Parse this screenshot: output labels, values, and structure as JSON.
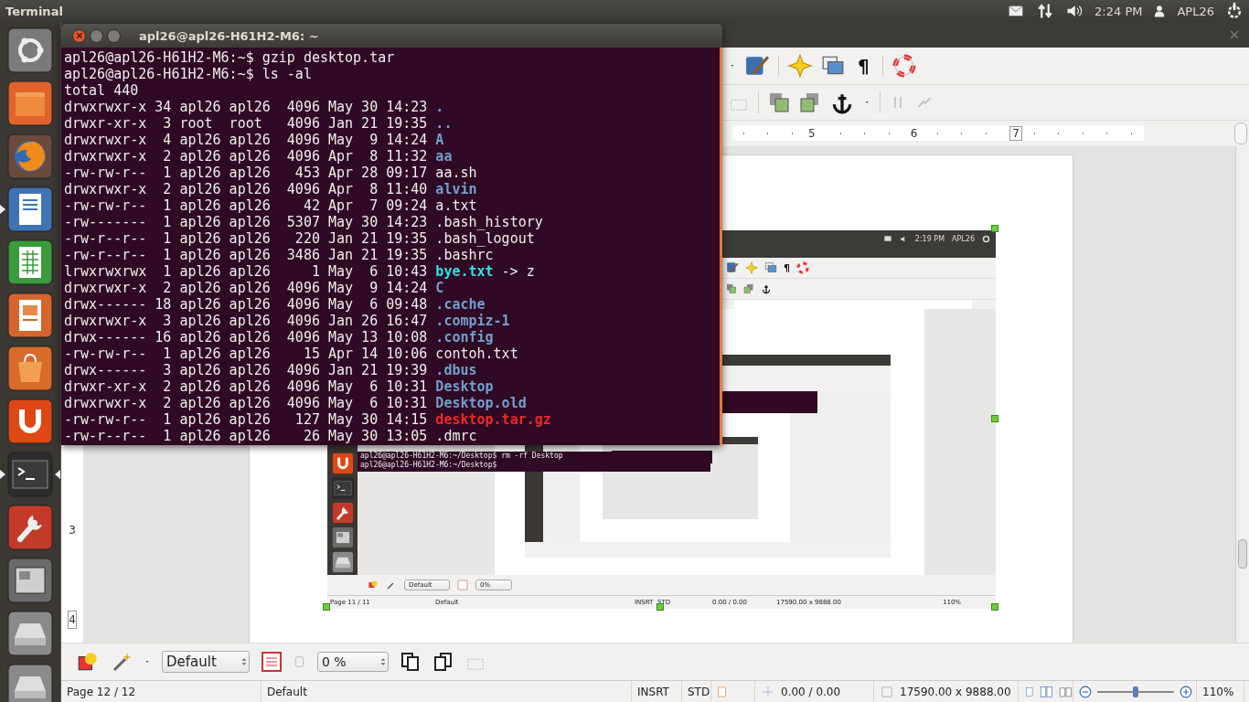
{
  "top_panel": {
    "app_title": "Terminal",
    "time": "2:24 PM",
    "user": "APL26"
  },
  "launcher": [
    {
      "kind": "dash",
      "running": false,
      "focused": false
    },
    {
      "kind": "files",
      "running": false,
      "focused": false
    },
    {
      "kind": "browser",
      "running": false,
      "focused": false
    },
    {
      "kind": "writer",
      "running": true,
      "focused": false
    },
    {
      "kind": "calc",
      "running": false,
      "focused": false
    },
    {
      "kind": "impress",
      "running": false,
      "focused": false
    },
    {
      "kind": "store",
      "running": false,
      "focused": false
    },
    {
      "kind": "cloud",
      "running": false,
      "focused": false
    },
    {
      "kind": "terminal",
      "running": true,
      "focused": true
    },
    {
      "kind": "settings",
      "running": false,
      "focused": false
    },
    {
      "kind": "workspaces",
      "running": false,
      "focused": false
    },
    {
      "kind": "drive",
      "running": false,
      "focused": false
    },
    {
      "kind": "drive",
      "running": false,
      "focused": false
    }
  ],
  "terminal": {
    "title": "apl26@apl26-H61H2-M6: ~",
    "lines": [
      {
        "kind": "plain",
        "text": "apl26@apl26-H61H2-M6:~$ gzip desktop.tar"
      },
      {
        "kind": "plain",
        "text": "apl26@apl26-H61H2-M6:~$ ls -al"
      },
      {
        "kind": "plain",
        "text": "total 440"
      },
      {
        "kind": "dir",
        "info": "drwxrwxr-x 34 apl26 apl26  4096 May 30 14:23",
        "name": "."
      },
      {
        "kind": "dir",
        "info": "drwxr-xr-x  3 root  root   4096 Jan 21 19:35",
        "name": ".."
      },
      {
        "kind": "dir",
        "info": "drwxrwxr-x  4 apl26 apl26  4096 May  9 14:24",
        "name": "A"
      },
      {
        "kind": "dir",
        "info": "drwxrwxr-x  2 apl26 apl26  4096 Apr  8 11:32",
        "name": "aa"
      },
      {
        "kind": "file",
        "info": "-rw-rw-r--  1 apl26 apl26   453 Apr 28 09:17",
        "name": "aa.sh"
      },
      {
        "kind": "dir",
        "info": "drwxrwxr-x  2 apl26 apl26  4096 Apr  8 11:40",
        "name": "alvin"
      },
      {
        "kind": "file",
        "info": "-rw-rw-r--  1 apl26 apl26    42 Apr  7 09:24",
        "name": "a.txt"
      },
      {
        "kind": "file",
        "info": "-rw-------  1 apl26 apl26  5307 May 30 14:23",
        "name": ".bash_history"
      },
      {
        "kind": "file",
        "info": "-rw-r--r--  1 apl26 apl26   220 Jan 21 19:35",
        "name": ".bash_logout"
      },
      {
        "kind": "file",
        "info": "-rw-r--r--  1 apl26 apl26  3486 Jan 21 19:35",
        "name": ".bashrc"
      },
      {
        "kind": "link",
        "info": "lrwxrwxrwx  1 apl26 apl26     1 May  6 10:43",
        "name": "bye.txt",
        "target": "-> z"
      },
      {
        "kind": "dir",
        "info": "drwxrwxr-x  2 apl26 apl26  4096 May  9 14:24",
        "name": "C"
      },
      {
        "kind": "dir",
        "info": "drwx------ 18 apl26 apl26  4096 May  6 09:48",
        "name": ".cache"
      },
      {
        "kind": "dir",
        "info": "drwxrwxr-x  3 apl26 apl26  4096 Jan 26 16:47",
        "name": ".compiz-1"
      },
      {
        "kind": "dir",
        "info": "drwx------ 16 apl26 apl26  4096 May 13 10:08",
        "name": ".config"
      },
      {
        "kind": "file",
        "info": "-rw-rw-r--  1 apl26 apl26    15 Apr 14 10:06",
        "name": "contoh.txt"
      },
      {
        "kind": "dir",
        "info": "drwx------  3 apl26 apl26  4096 Jan 21 19:39",
        "name": ".dbus"
      },
      {
        "kind": "dir",
        "info": "drwxr-xr-x  2 apl26 apl26  4096 May  6 10:31",
        "name": "Desktop"
      },
      {
        "kind": "dir",
        "info": "drwxrwxr-x  2 apl26 apl26  4096 May  6 10:31",
        "name": "Desktop.old"
      },
      {
        "kind": "archive",
        "info": "-rw-rw-r--  1 apl26 apl26   127 May 30 14:15",
        "name": "desktop.tar.gz"
      },
      {
        "kind": "file",
        "info": "-rw-r--r--  1 apl26 apl26    26 May 30 13:05",
        "name": ".dmrc"
      }
    ]
  },
  "writer": {
    "pilcrow": "¶",
    "ruler_labels": [
      "5",
      "6",
      "7"
    ],
    "vertical_ruler_labels": [
      "3",
      "4"
    ],
    "embedded_screenshot": {
      "time": "2:19 PM",
      "user": "APL26",
      "pilcrow": "¶",
      "terminal_lines": [
        "apl26@apl26-H61H2-M6:~/Desktop$ rm -rf Desktop",
        "apl26@apl26-H61H2-M6:~/Desktop$"
      ],
      "paragraph_style": "Default",
      "transparency": "0%",
      "status_bar": {
        "page": "Page 11 / 11",
        "page_style": "Default",
        "insert_mode": "INSRT",
        "selection_mode": "STD",
        "position": "0.00 / 0.00",
        "size": "17590.00 x 9888.00",
        "zoom": "110%"
      }
    },
    "bottom_toolbar": {
      "paragraph_style": "Default",
      "transparency": "0 %"
    },
    "status_bar": {
      "page": "Page 12 / 12",
      "page_style": "Default",
      "insert_mode": "INSRT",
      "selection_mode": "STD",
      "position": "0.00 / 0.00",
      "size": "17590.00 x 9888.00",
      "zoom": {
        "level": 0.5,
        "reading": "110%"
      }
    }
  }
}
